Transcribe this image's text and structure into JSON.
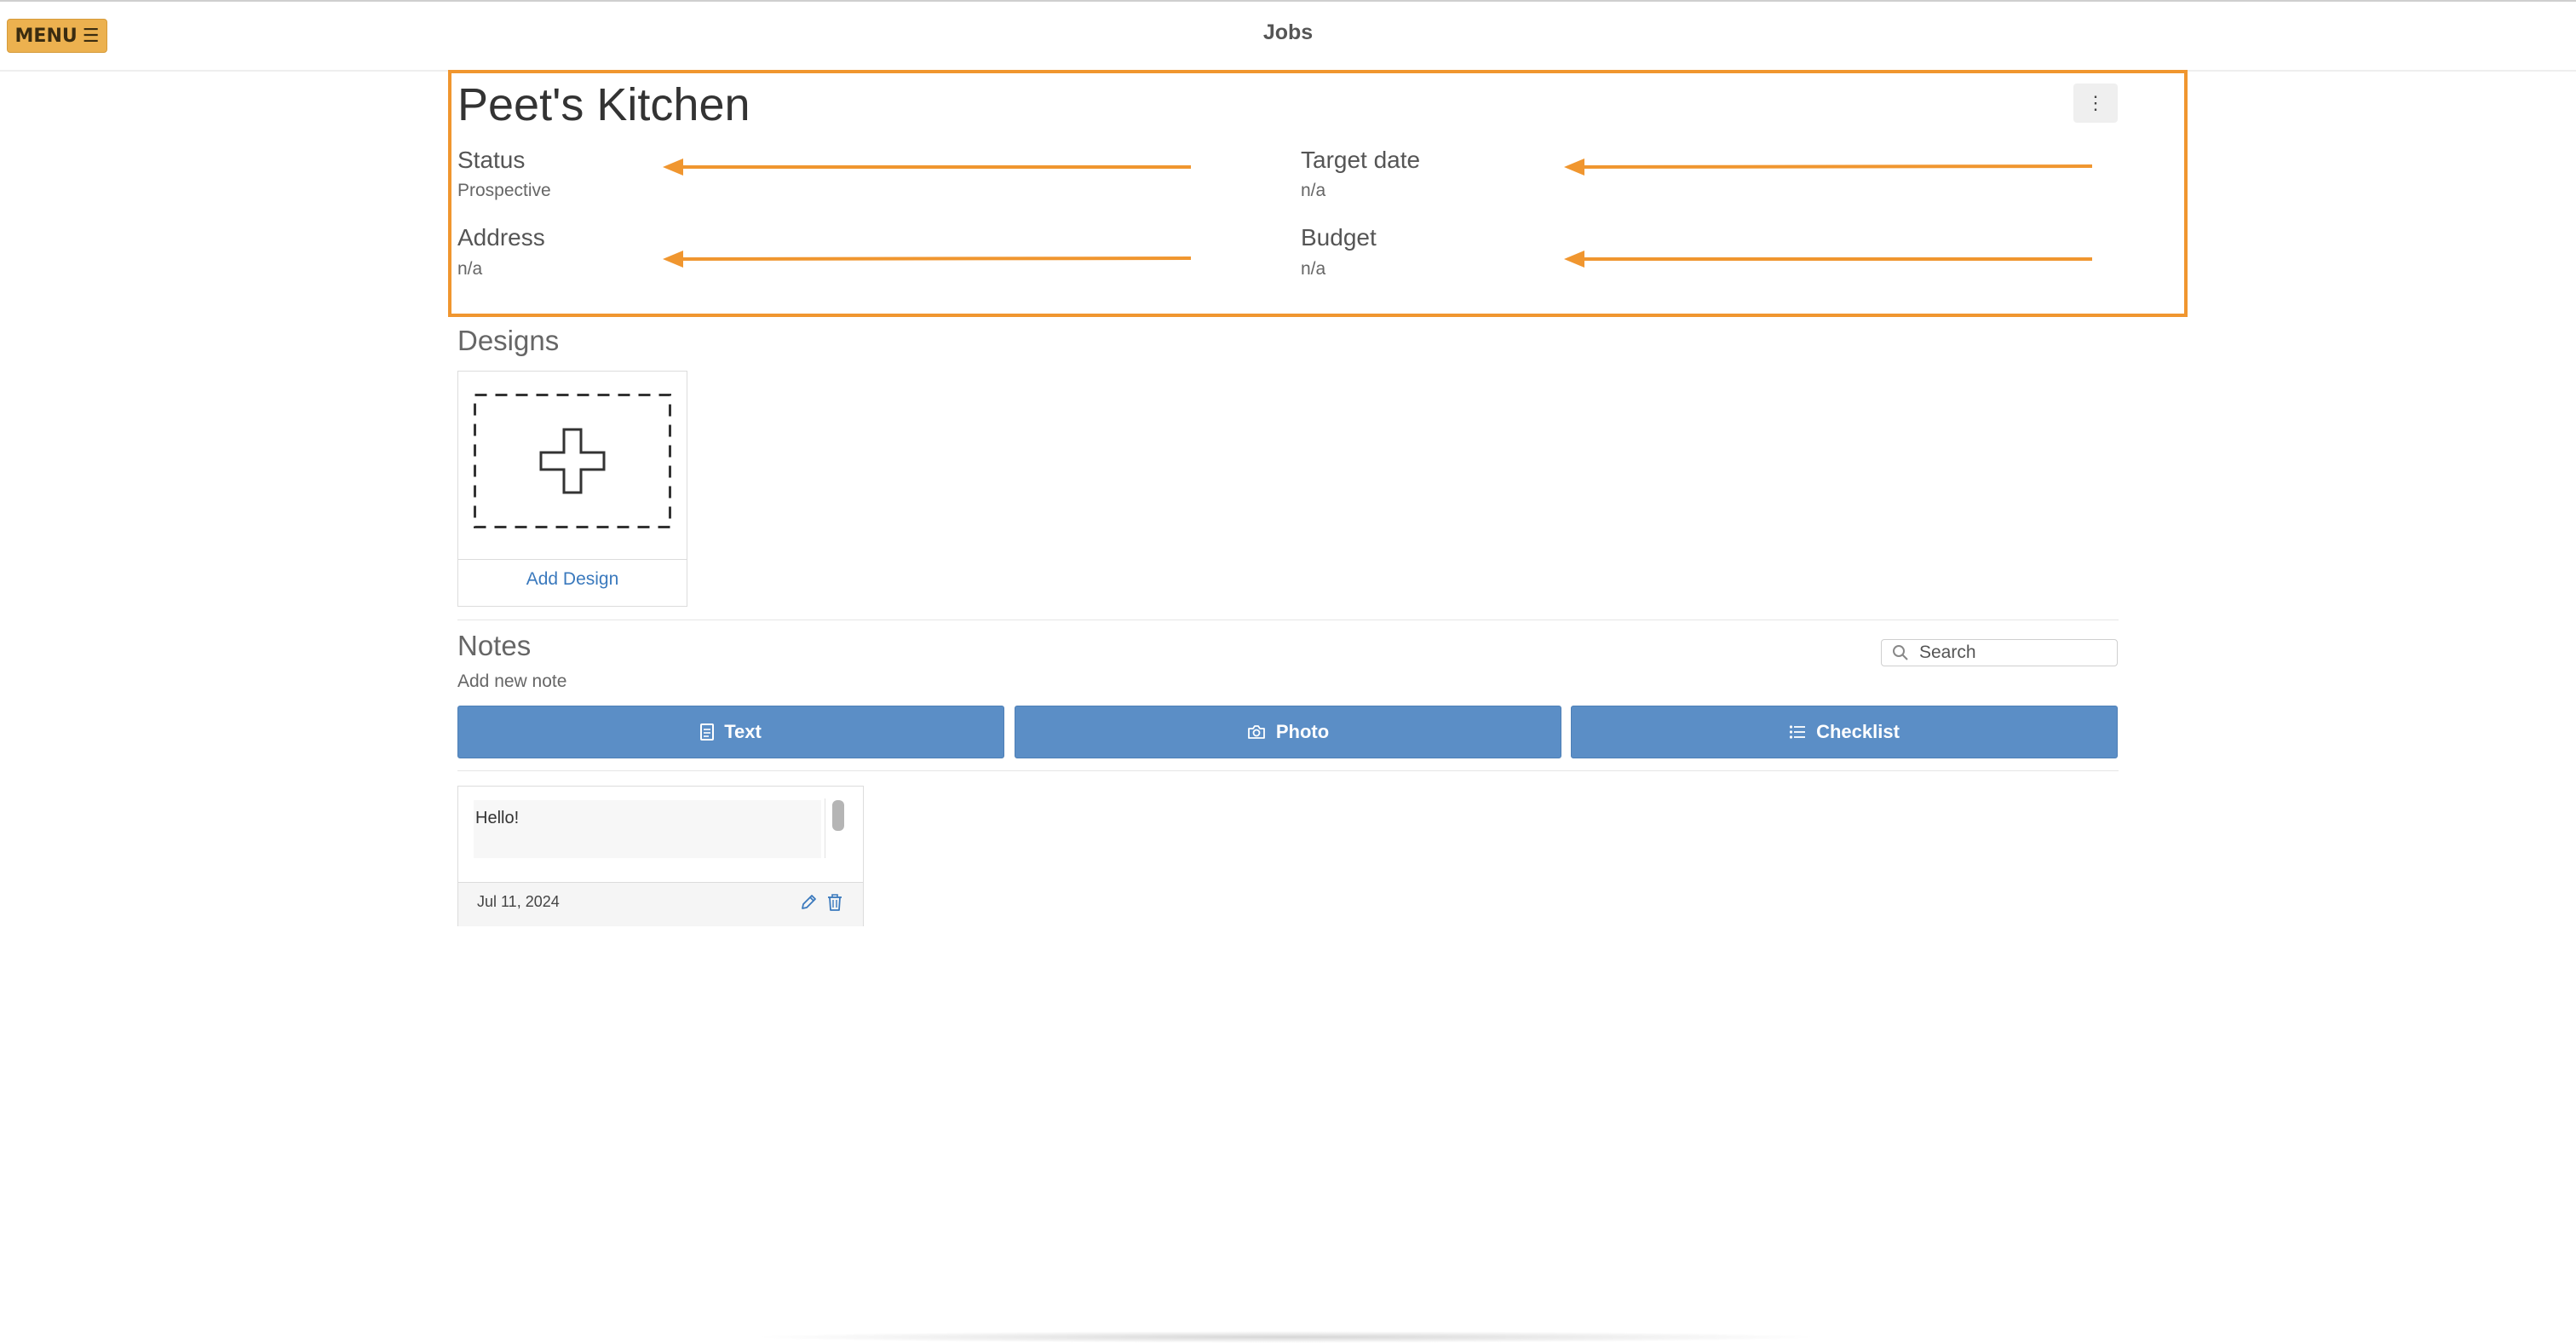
{
  "header": {
    "menu_label": "MENU",
    "menu_icon": "☰",
    "title": "Jobs"
  },
  "job": {
    "name": "Peet's Kitchen",
    "more_icon": "⋮",
    "status_label": "Status",
    "status_value": "Prospective",
    "target_date_label": "Target date",
    "target_date_value": "n/a",
    "address_label": "Address",
    "address_value": "n/a",
    "budget_label": "Budget",
    "budget_value": "n/a"
  },
  "designs": {
    "title": "Designs",
    "add_label": "Add Design"
  },
  "notes": {
    "title": "Notes",
    "search_placeholder": "Search",
    "add_new_label": "Add new note",
    "buttons": [
      {
        "label": "Text",
        "icon": "document-icon"
      },
      {
        "label": "Photo",
        "icon": "camera-icon"
      },
      {
        "label": "Checklist",
        "icon": "list-icon"
      }
    ],
    "items": [
      {
        "text": "Hello!",
        "date": "Jul 11, 2024"
      }
    ]
  },
  "colors": {
    "accent": "#f0962f",
    "menu": "#ecb14f",
    "button": "#5b8ec6",
    "link": "#3a79bd"
  }
}
